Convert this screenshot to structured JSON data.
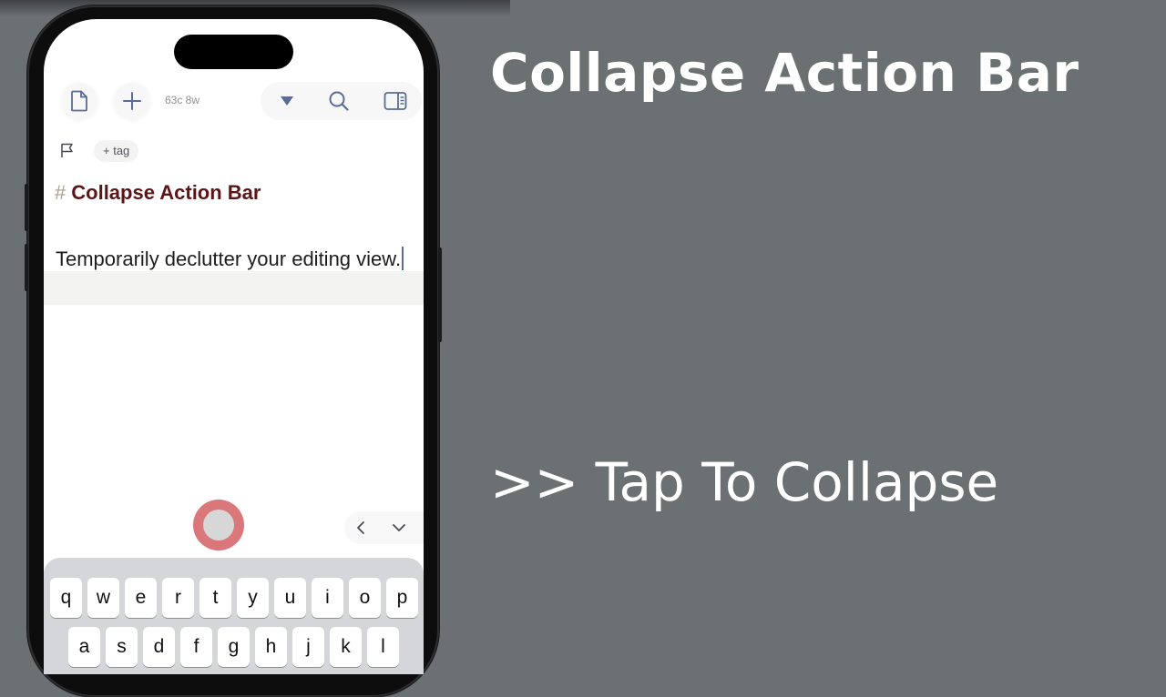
{
  "slide": {
    "title": "Collapse Action Bar",
    "hint": ">> Tap To Collapse"
  },
  "toolbar": {
    "icons": [
      "document-icon",
      "plus-icon",
      "dropdown-triangle-icon",
      "search-icon",
      "sidebar-panel-icon"
    ],
    "counter": "63c 8w"
  },
  "tags": {
    "flag_icon": "flag-icon",
    "add_tag_label": "+ tag"
  },
  "note": {
    "heading_marker": "#",
    "heading": "Collapse Action Bar",
    "body": "Temporarily declutter your editing view."
  },
  "action_bar": {
    "icons": [
      "chevron-left-icon",
      "chevron-down-icon"
    ],
    "tap_indicator_color": "#d9777a"
  },
  "keyboard": {
    "row1": [
      "q",
      "w",
      "e",
      "r",
      "t",
      "y",
      "u",
      "i",
      "o",
      "p"
    ],
    "row2": [
      "a",
      "s",
      "d",
      "f",
      "g",
      "h",
      "j",
      "k",
      "l"
    ]
  },
  "colors": {
    "background": "#6b7072",
    "heading": "#5c1517",
    "accent": "#5a6c93"
  }
}
